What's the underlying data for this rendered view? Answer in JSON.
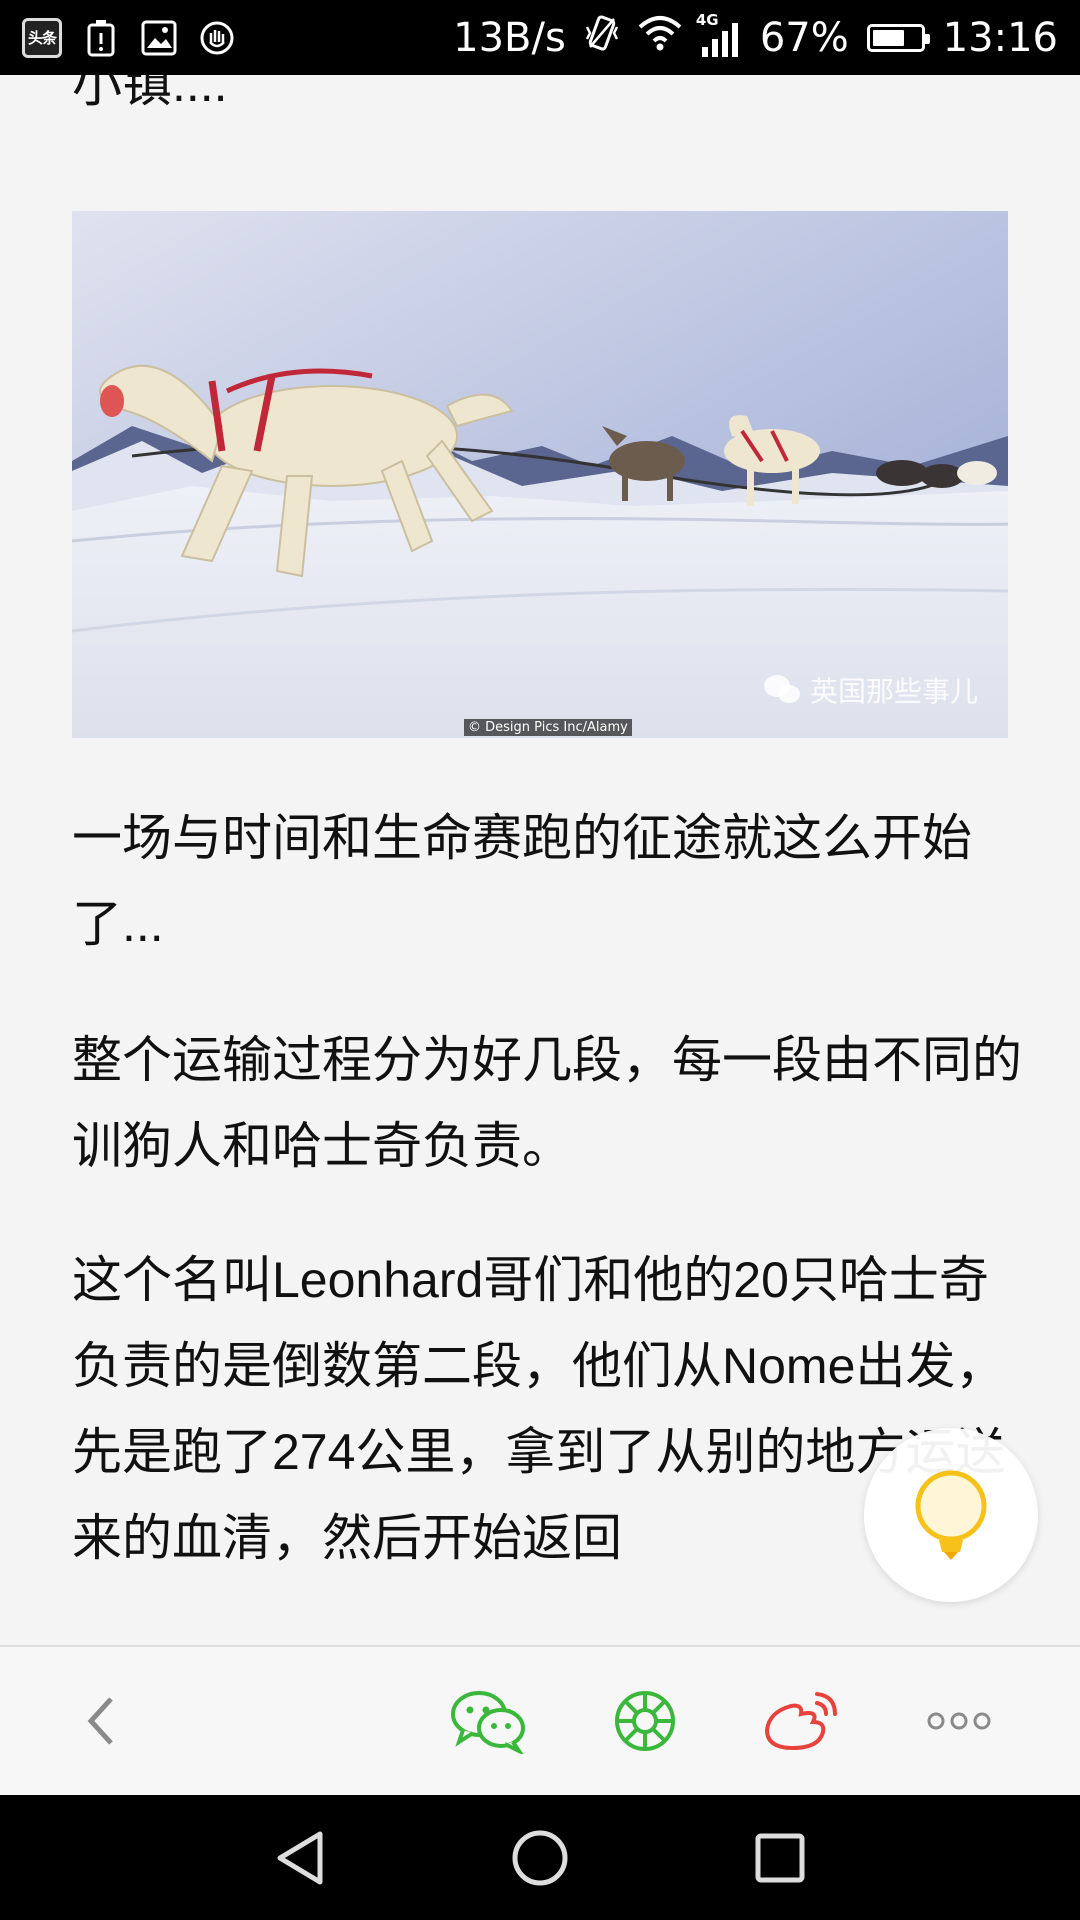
{
  "status_bar": {
    "app_badge": "头条",
    "net_speed": "13B/s",
    "network_type": "4G",
    "battery_text": "67%",
    "battery_level": 0.67,
    "time": "13:16"
  },
  "article": {
    "paragraphs": [
      "小镇....",
      "一场与时间和生命赛跑的征途就这么开始了...",
      "整个运输过程分为好几段，每一段由不同的训狗人和哈士奇负责。",
      "这个名叫Leonhard哥们和他的20只哈士奇负责的是倒数第二段，他们从Nome出发，先是跑了274公里，拿到了从别的地方运送来的血清，然后开始返回"
    ],
    "image": {
      "watermark": "英国那些事儿",
      "credit": "© Design Pics Inc/Alamy"
    }
  },
  "fab": {
    "icon": "lightbulb-icon"
  },
  "toolbar": {
    "back_icon": "back-chevron-icon",
    "wechat_icon": "wechat-icon",
    "moments_icon": "moments-icon",
    "weibo_icon": "weibo-icon",
    "more_icon": "more-icon",
    "colors": {
      "wechat": "#3bb83b",
      "moments": "#3bb83b",
      "weibo": "#e8423c"
    }
  },
  "nav_bar": {
    "back_icon": "nav-back-icon",
    "home_icon": "nav-home-icon",
    "recents_icon": "nav-recents-icon"
  }
}
